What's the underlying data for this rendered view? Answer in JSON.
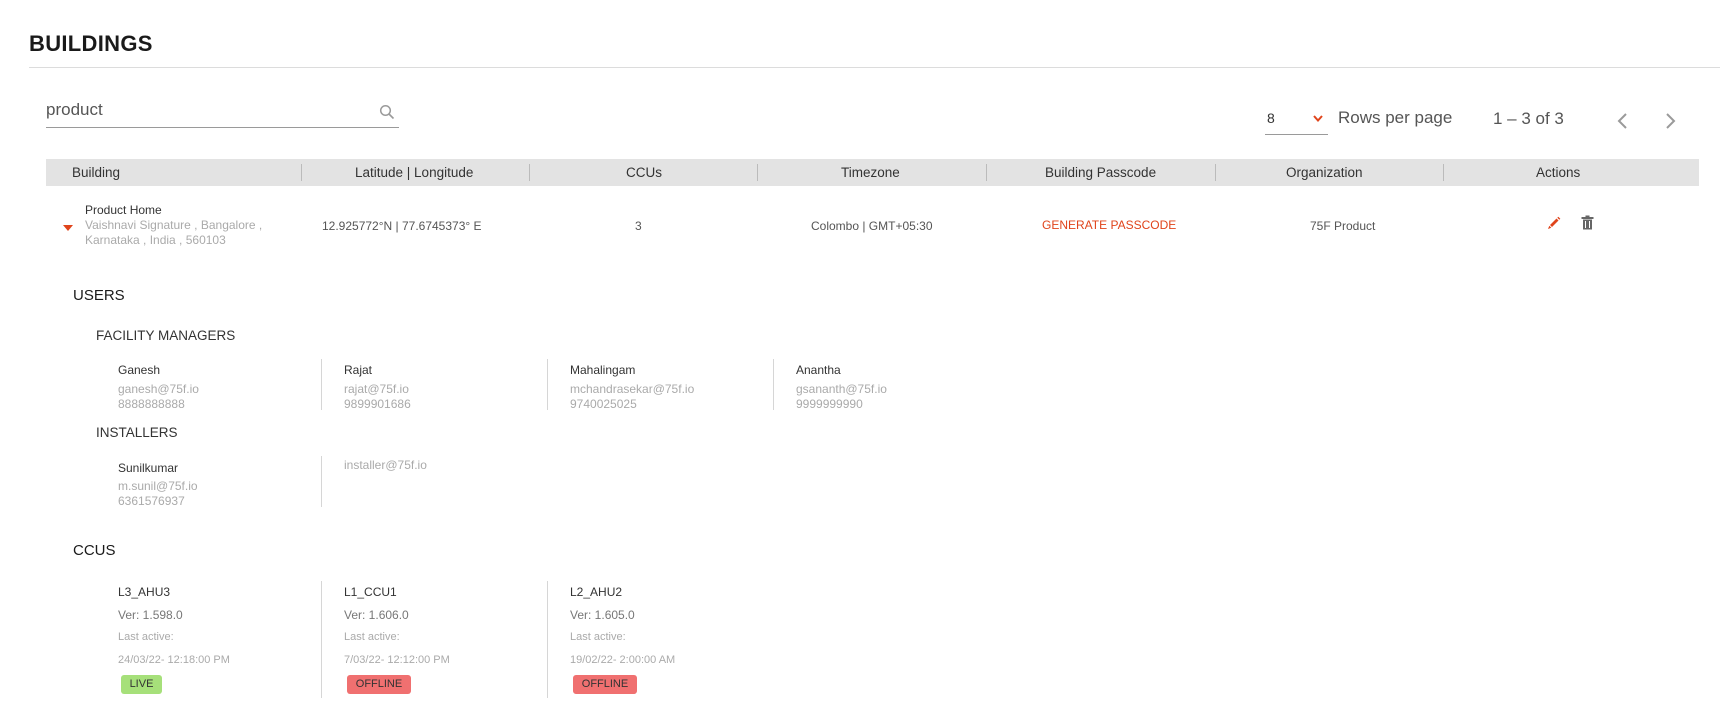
{
  "page": {
    "title": "BUILDINGS"
  },
  "search": {
    "value": "product",
    "icon": "search-icon"
  },
  "pagination": {
    "rows_value": "8",
    "rows_label": "Rows per page",
    "range": "1 – 3 of 3"
  },
  "table": {
    "headers": [
      "Building",
      "Latitude | Longitude",
      "CCUs",
      "Timezone",
      "Building Passcode",
      "Organization",
      "Actions"
    ],
    "row": {
      "name": "Product Home",
      "address": "Vaishnavi Signature , Bangalore , Karnataka , India , 560103",
      "latlng": "12.925772°N | 77.6745373° E",
      "ccus": "3",
      "timezone": "Colombo | GMT+05:30",
      "passcode_action": "GENERATE PASSCODE",
      "organization": "75F Product"
    }
  },
  "users": {
    "title": "USERS",
    "facility_title": "FACILITY MANAGERS",
    "facility_managers": [
      {
        "name": "Ganesh",
        "email": "ganesh@75f.io",
        "phone": "8888888888"
      },
      {
        "name": "Rajat",
        "email": "rajat@75f.io",
        "phone": "9899901686"
      },
      {
        "name": "Mahalingam",
        "email": "mchandrasekar@75f.io",
        "phone": "9740025025"
      },
      {
        "name": "Anantha",
        "email": "gsananth@75f.io",
        "phone": "9999999990"
      }
    ],
    "installers_title": "INSTALLERS",
    "installers": [
      {
        "name": "Sunilkumar",
        "email": "m.sunil@75f.io",
        "phone": "6361576937"
      },
      {
        "email": "installer@75f.io"
      }
    ]
  },
  "ccus": {
    "title": "CCUS",
    "items": [
      {
        "name": "L3_AHU3",
        "version": "Ver: 1.598.0",
        "last_active_label": "Last active:",
        "last_active": "24/03/22- 12:18:00 PM",
        "status": "LIVE"
      },
      {
        "name": "L1_CCU1",
        "version": "Ver: 1.606.0",
        "last_active_label": "Last active:",
        "last_active": "7/03/22- 12:12:00 PM",
        "status": "OFFLINE"
      },
      {
        "name": "L2_AHU2",
        "version": "Ver: 1.605.0",
        "last_active_label": "Last active:",
        "last_active": "19/02/22- 2:00:00 AM",
        "status": "OFFLINE"
      }
    ]
  },
  "colors": {
    "accent": "#e0441b",
    "header_bg": "#e3e3e3",
    "live": "#a6e07a",
    "offline": "#f07070"
  }
}
